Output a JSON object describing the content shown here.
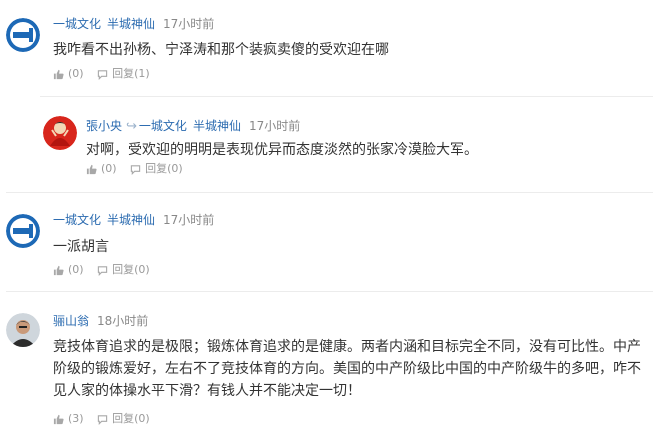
{
  "comments": [
    {
      "users": [
        "一城文化",
        "半城神仙"
      ],
      "time": "17小时前",
      "text": "我咋看不出孙杨、宁泽涛和那个装疯卖傻的受欢迎在哪",
      "like": "(0)",
      "reply": "回复(1)",
      "avatar_icon": "key-avatar-icon"
    },
    {
      "users": [
        "張小央"
      ],
      "reply_to": [
        "一城文化",
        "半城神仙"
      ],
      "time": "17小时前",
      "text": "对啊，受欢迎的明明是表现优异而态度淡然的张家冷漠脸大军。",
      "like": "(0)",
      "reply": "回复(0)",
      "avatar_icon": "red-robe-person-avatar"
    },
    {
      "users": [
        "一城文化",
        "半城神仙"
      ],
      "time": "17小时前",
      "text": "一派胡言",
      "like": "(0)",
      "reply": "回复(0)",
      "avatar_icon": "key-avatar-icon"
    },
    {
      "users": [
        "骊山翁"
      ],
      "time": "18小时前",
      "text_lines": [
        "竞技体育追求的是极限；锻炼体育追求的是健康。两者内涵和目标完全不同，没有可比性。中产",
        "阶级的锻炼爱好，左右不了竞技体育的方向。美国的中产阶级比中国的中产阶级牛的多吧，咋不",
        "见人家的体操水平下滑？有钱人并不能决定一切！"
      ],
      "like": "(3)",
      "reply": "回复(0)",
      "avatar_icon": "man-photo-avatar"
    }
  ],
  "icons": {
    "like": "thumbs-up-icon",
    "reply": "reply-icon",
    "reply_arrow": "reply-arrow-icon"
  },
  "colors": {
    "username": "#2b6bb0",
    "meta": "#888888",
    "avatar_blue": "#1d69b6"
  }
}
